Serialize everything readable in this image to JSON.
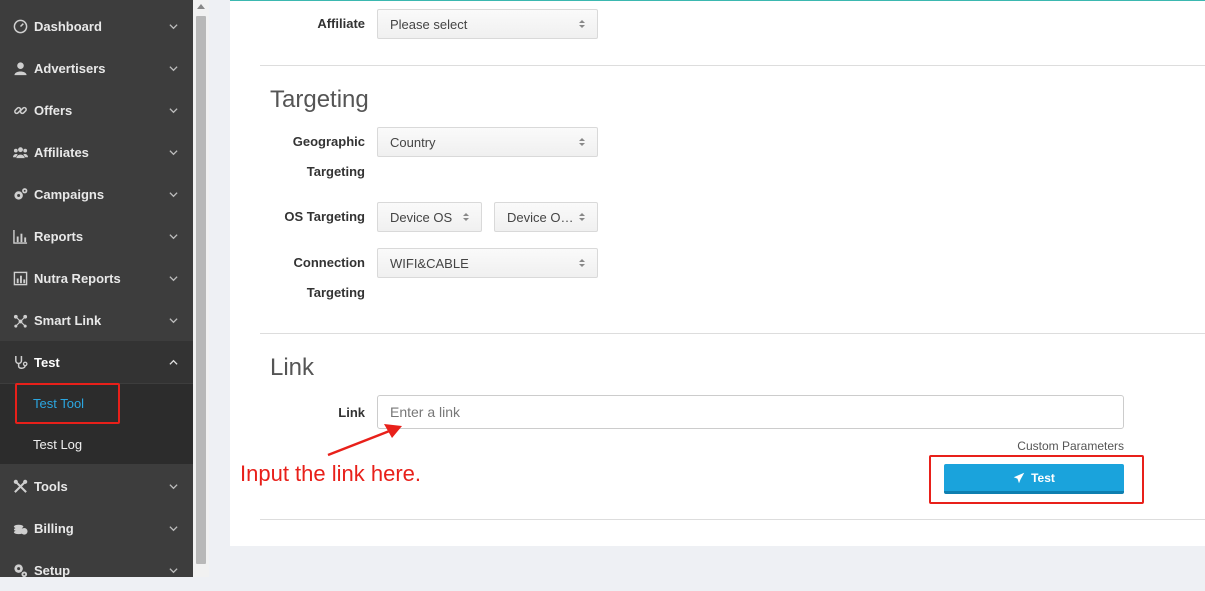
{
  "sidebar": {
    "items": [
      {
        "label": "Dashboard",
        "icon": "gauge-icon",
        "chevron": "down"
      },
      {
        "label": "Advertisers",
        "icon": "user-icon",
        "chevron": "down"
      },
      {
        "label": "Offers",
        "icon": "link-icon",
        "chevron": "down"
      },
      {
        "label": "Affiliates",
        "icon": "users-icon",
        "chevron": "down"
      },
      {
        "label": "Campaigns",
        "icon": "cogs-icon",
        "chevron": "down"
      },
      {
        "label": "Reports",
        "icon": "bar-chart-icon",
        "chevron": "down"
      },
      {
        "label": "Nutra Reports",
        "icon": "report-icon",
        "chevron": "down"
      },
      {
        "label": "Smart Link",
        "icon": "network-icon",
        "chevron": "down"
      },
      {
        "label": "Test",
        "icon": "stethoscope-icon",
        "chevron": "up"
      },
      {
        "label": "Tools",
        "icon": "tools-icon",
        "chevron": "down"
      },
      {
        "label": "Billing",
        "icon": "coins-icon",
        "chevron": "down"
      },
      {
        "label": "Setup",
        "icon": "gears-icon",
        "chevron": "down"
      }
    ],
    "test_submenu": [
      {
        "label": "Test Tool",
        "selected": true
      },
      {
        "label": "Test Log",
        "selected": false
      }
    ]
  },
  "form": {
    "affiliate": {
      "label": "Affiliate",
      "value": "Please select"
    },
    "targeting_title": "Targeting",
    "geo": {
      "label_line1": "Geographic",
      "label_line2": "Targeting",
      "value": "Country"
    },
    "os": {
      "label": "OS Targeting",
      "value1": "Device OS",
      "value2": "Device OS..."
    },
    "connection": {
      "label_line1": "Connection",
      "label_line2": "Targeting",
      "value": "WIFI&CABLE"
    },
    "link_title": "Link",
    "link": {
      "label": "Link",
      "placeholder": "Enter a link",
      "value": ""
    },
    "custom_params": "Custom Parameters",
    "test_button": "Test"
  },
  "annotation": {
    "text": "Input the link here.",
    "color": "#e8201a"
  },
  "colors": {
    "accent": "#1aa3dc",
    "sidebar": "#3d3d3d",
    "highlight": "#e8201a"
  }
}
